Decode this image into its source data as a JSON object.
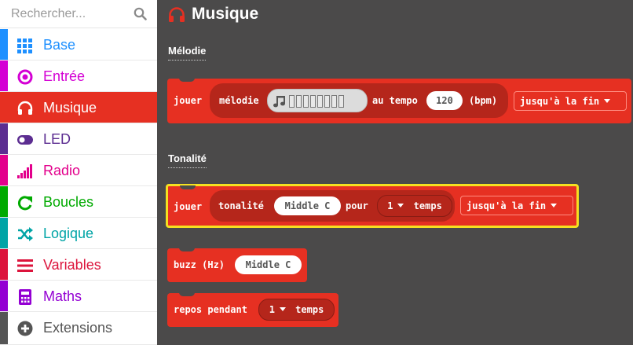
{
  "search": {
    "placeholder": "Rechercher..."
  },
  "categories": [
    {
      "label": "Base",
      "color": "#1e90ff",
      "icon": "grid-icon"
    },
    {
      "label": "Entrée",
      "color": "#d400d4",
      "icon": "radio-button-icon"
    },
    {
      "label": "Musique",
      "color": "#e63022",
      "icon": "headphones-icon"
    },
    {
      "label": "LED",
      "color": "#5c2d91",
      "icon": "toggle-icon"
    },
    {
      "label": "Radio",
      "color": "#e3008c",
      "icon": "signal-bars-icon"
    },
    {
      "label": "Boucles",
      "color": "#00aa00",
      "icon": "refresh-icon"
    },
    {
      "label": "Logique",
      "color": "#00a4a6",
      "icon": "shuffle-icon"
    },
    {
      "label": "Variables",
      "color": "#dc143c",
      "icon": "list-icon"
    },
    {
      "label": "Maths",
      "color": "#9400d3",
      "icon": "calculator-icon"
    },
    {
      "label": "Extensions",
      "color": "#555555",
      "icon": "plus-circle-icon"
    }
  ],
  "workspace": {
    "title": "Musique",
    "title_icon": "headphones-icon",
    "sections": {
      "melodie": "Mélodie",
      "tonalite": "Tonalité"
    }
  },
  "blocks": {
    "play_melody": {
      "play": "jouer",
      "melody": "mélodie",
      "tempo_label": "au tempo",
      "tempo_value": "120",
      "bpm": "(bpm)",
      "mode": "jusqu'à la fin"
    },
    "play_tone": {
      "play": "jouer",
      "tone": "tonalité",
      "note": "Middle C",
      "for": "pour",
      "beats_value": "1",
      "beats": "temps",
      "mode": "jusqu'à la fin"
    },
    "buzz": {
      "label": "buzz (Hz)",
      "note": "Middle C"
    },
    "rest": {
      "label": "repos pendant",
      "beats_value": "1",
      "beats": "temps"
    }
  },
  "colors": {
    "selected": "#e63022",
    "block": "#e63022",
    "workspace": "#4b4a4a",
    "highlight": "#f5e020"
  }
}
